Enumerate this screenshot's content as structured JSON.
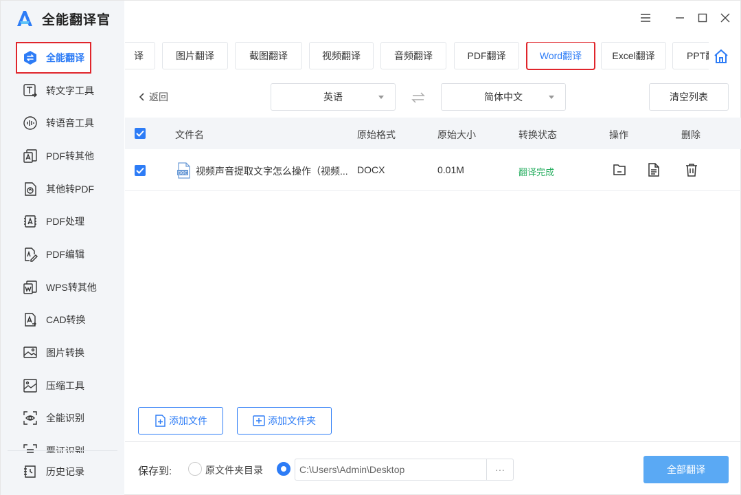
{
  "app": {
    "title": "全能翻译官",
    "accent": "#2d7cf6",
    "highlight": "#e0252b"
  },
  "sidebar": {
    "items": [
      {
        "label": "全能翻译",
        "icon": "translate-icon"
      },
      {
        "label": "转文字工具",
        "icon": "text-tool-icon"
      },
      {
        "label": "转语音工具",
        "icon": "voice-tool-icon"
      },
      {
        "label": "PDF转其他",
        "icon": "pdf-convert-icon"
      },
      {
        "label": "其他转PDF",
        "icon": "to-pdf-icon"
      },
      {
        "label": "PDF处理",
        "icon": "pdf-process-icon"
      },
      {
        "label": "PDF编辑",
        "icon": "pdf-edit-icon"
      },
      {
        "label": "WPS转其他",
        "icon": "wps-convert-icon"
      },
      {
        "label": "CAD转换",
        "icon": "cad-convert-icon"
      },
      {
        "label": "图片转换",
        "icon": "image-convert-icon"
      },
      {
        "label": "压缩工具",
        "icon": "compress-icon"
      },
      {
        "label": "全能识别",
        "icon": "recognize-icon"
      },
      {
        "label": "票证识别",
        "icon": "ticket-icon"
      }
    ],
    "history": "历史记录"
  },
  "tabs": [
    "译",
    "图片翻译",
    "截图翻译",
    "视频翻译",
    "音频翻译",
    "PDF翻译",
    "Word翻译",
    "Excel翻译",
    "PPT翻"
  ],
  "options": {
    "back": "返回",
    "source_lang": "英语",
    "target_lang": "简体中文",
    "clear": "清空列表"
  },
  "table": {
    "headers": {
      "name": "文件名",
      "format": "原始格式",
      "size": "原始大小",
      "status": "转换状态",
      "ops": "操作",
      "delete": "删除"
    },
    "rows": [
      {
        "name": "视频声音提取文字怎么操作（视频...",
        "format": "DOCX",
        "size": "0.01M",
        "status": "翻译完成",
        "file_icon": "DOC"
      }
    ]
  },
  "actions": {
    "add_file": "添加文件",
    "add_folder": "添加文件夹"
  },
  "footer": {
    "save_to": "保存到:",
    "opt_original": "原文件夹目录",
    "path": "C:\\Users\\Admin\\Desktop",
    "more": "···",
    "translate_all": "全部翻译"
  }
}
